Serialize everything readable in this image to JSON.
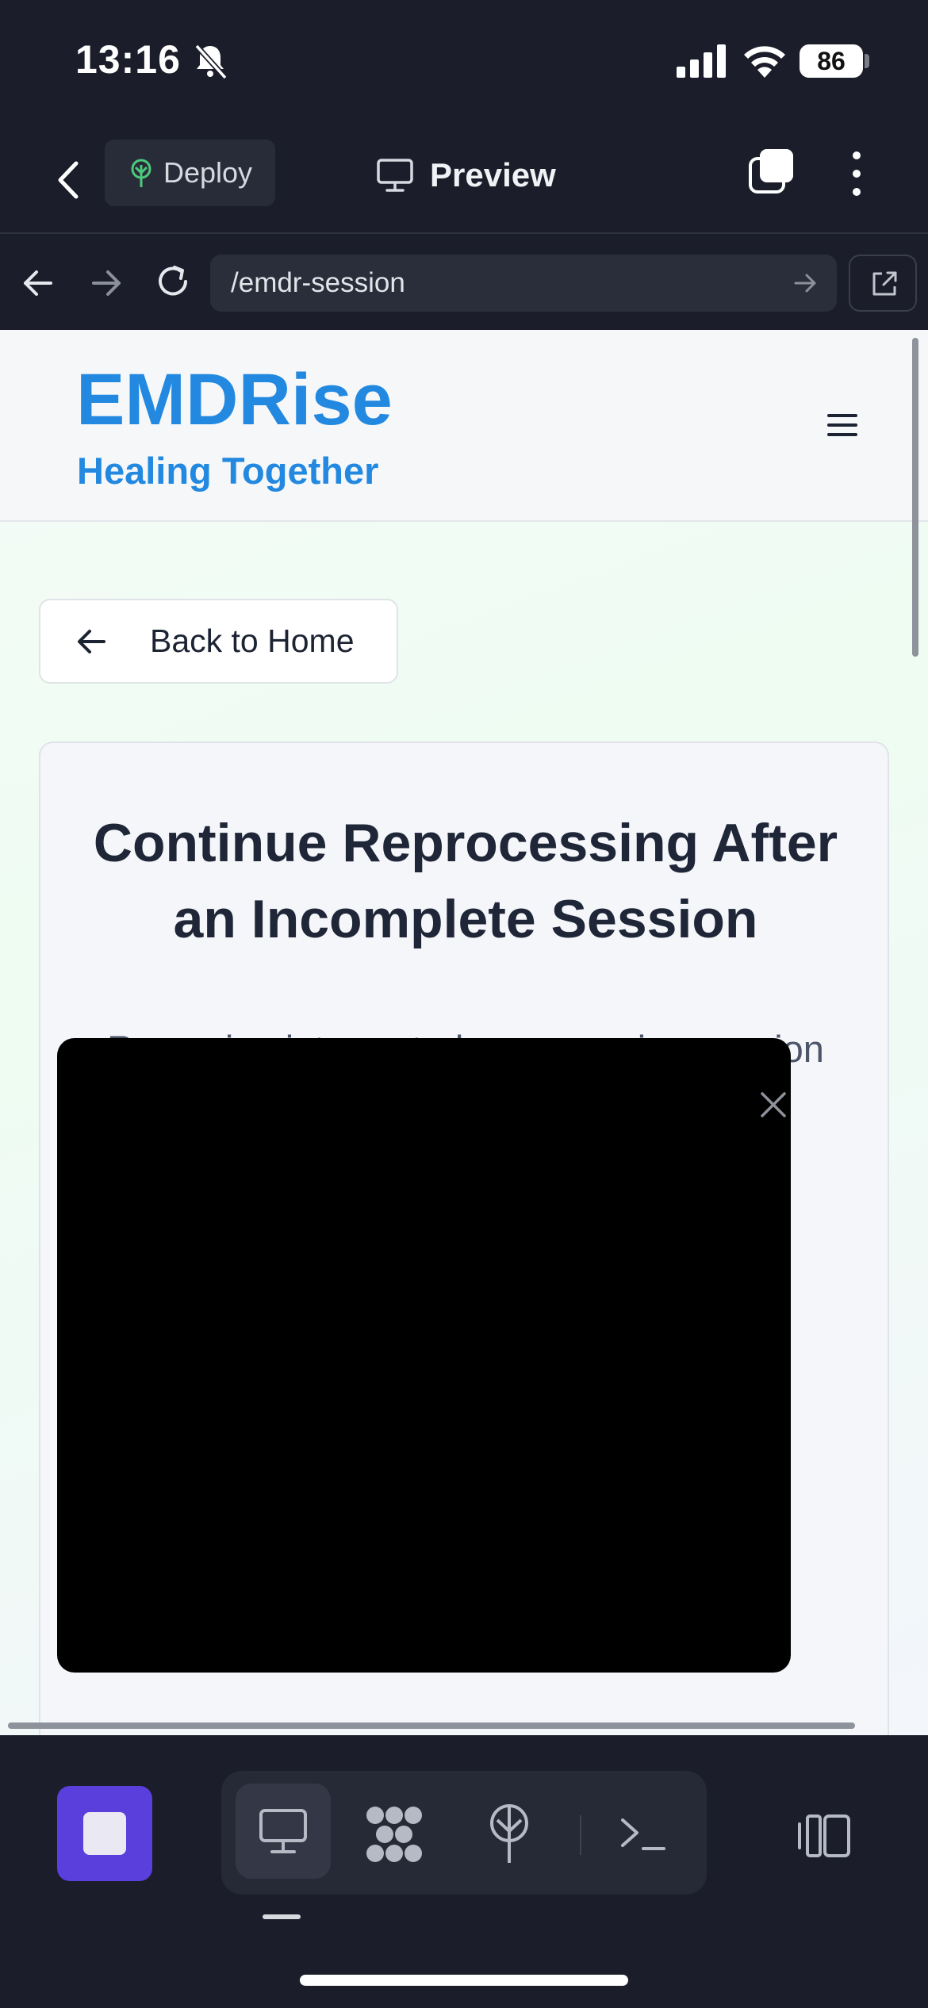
{
  "status_bar": {
    "time": "13:16",
    "battery": "86",
    "icons": [
      "bell-slash-icon",
      "signal-icon",
      "wifi-icon",
      "battery-icon"
    ]
  },
  "toolbar": {
    "deploy_label": "Deploy",
    "preview_label": "Preview",
    "icons": [
      "back-chevron-icon",
      "deploy-tree-icon",
      "monitor-icon",
      "tabs-icon",
      "more-vertical-icon"
    ]
  },
  "url_bar": {
    "url": "/emdr-session",
    "icons": [
      "arrow-left-icon",
      "arrow-right-icon",
      "reload-icon",
      "go-arrow-icon",
      "open-external-icon"
    ]
  },
  "site": {
    "brand_name": "EMDRise",
    "tagline": "Healing Together",
    "brand_color": "#2389e0",
    "back_button": "Back to Home",
    "card": {
      "title": "Continue Reprocessing After an Incomplete Session",
      "subtitle": "Resuming interrupted reprocessing session"
    }
  },
  "bottom_bar": {
    "accent_color": "#5b3fdc",
    "icons": [
      "stop-icon",
      "desktop-icon",
      "tiles-icon",
      "antenna-icon",
      "terminal-icon",
      "side-panel-icon"
    ]
  }
}
